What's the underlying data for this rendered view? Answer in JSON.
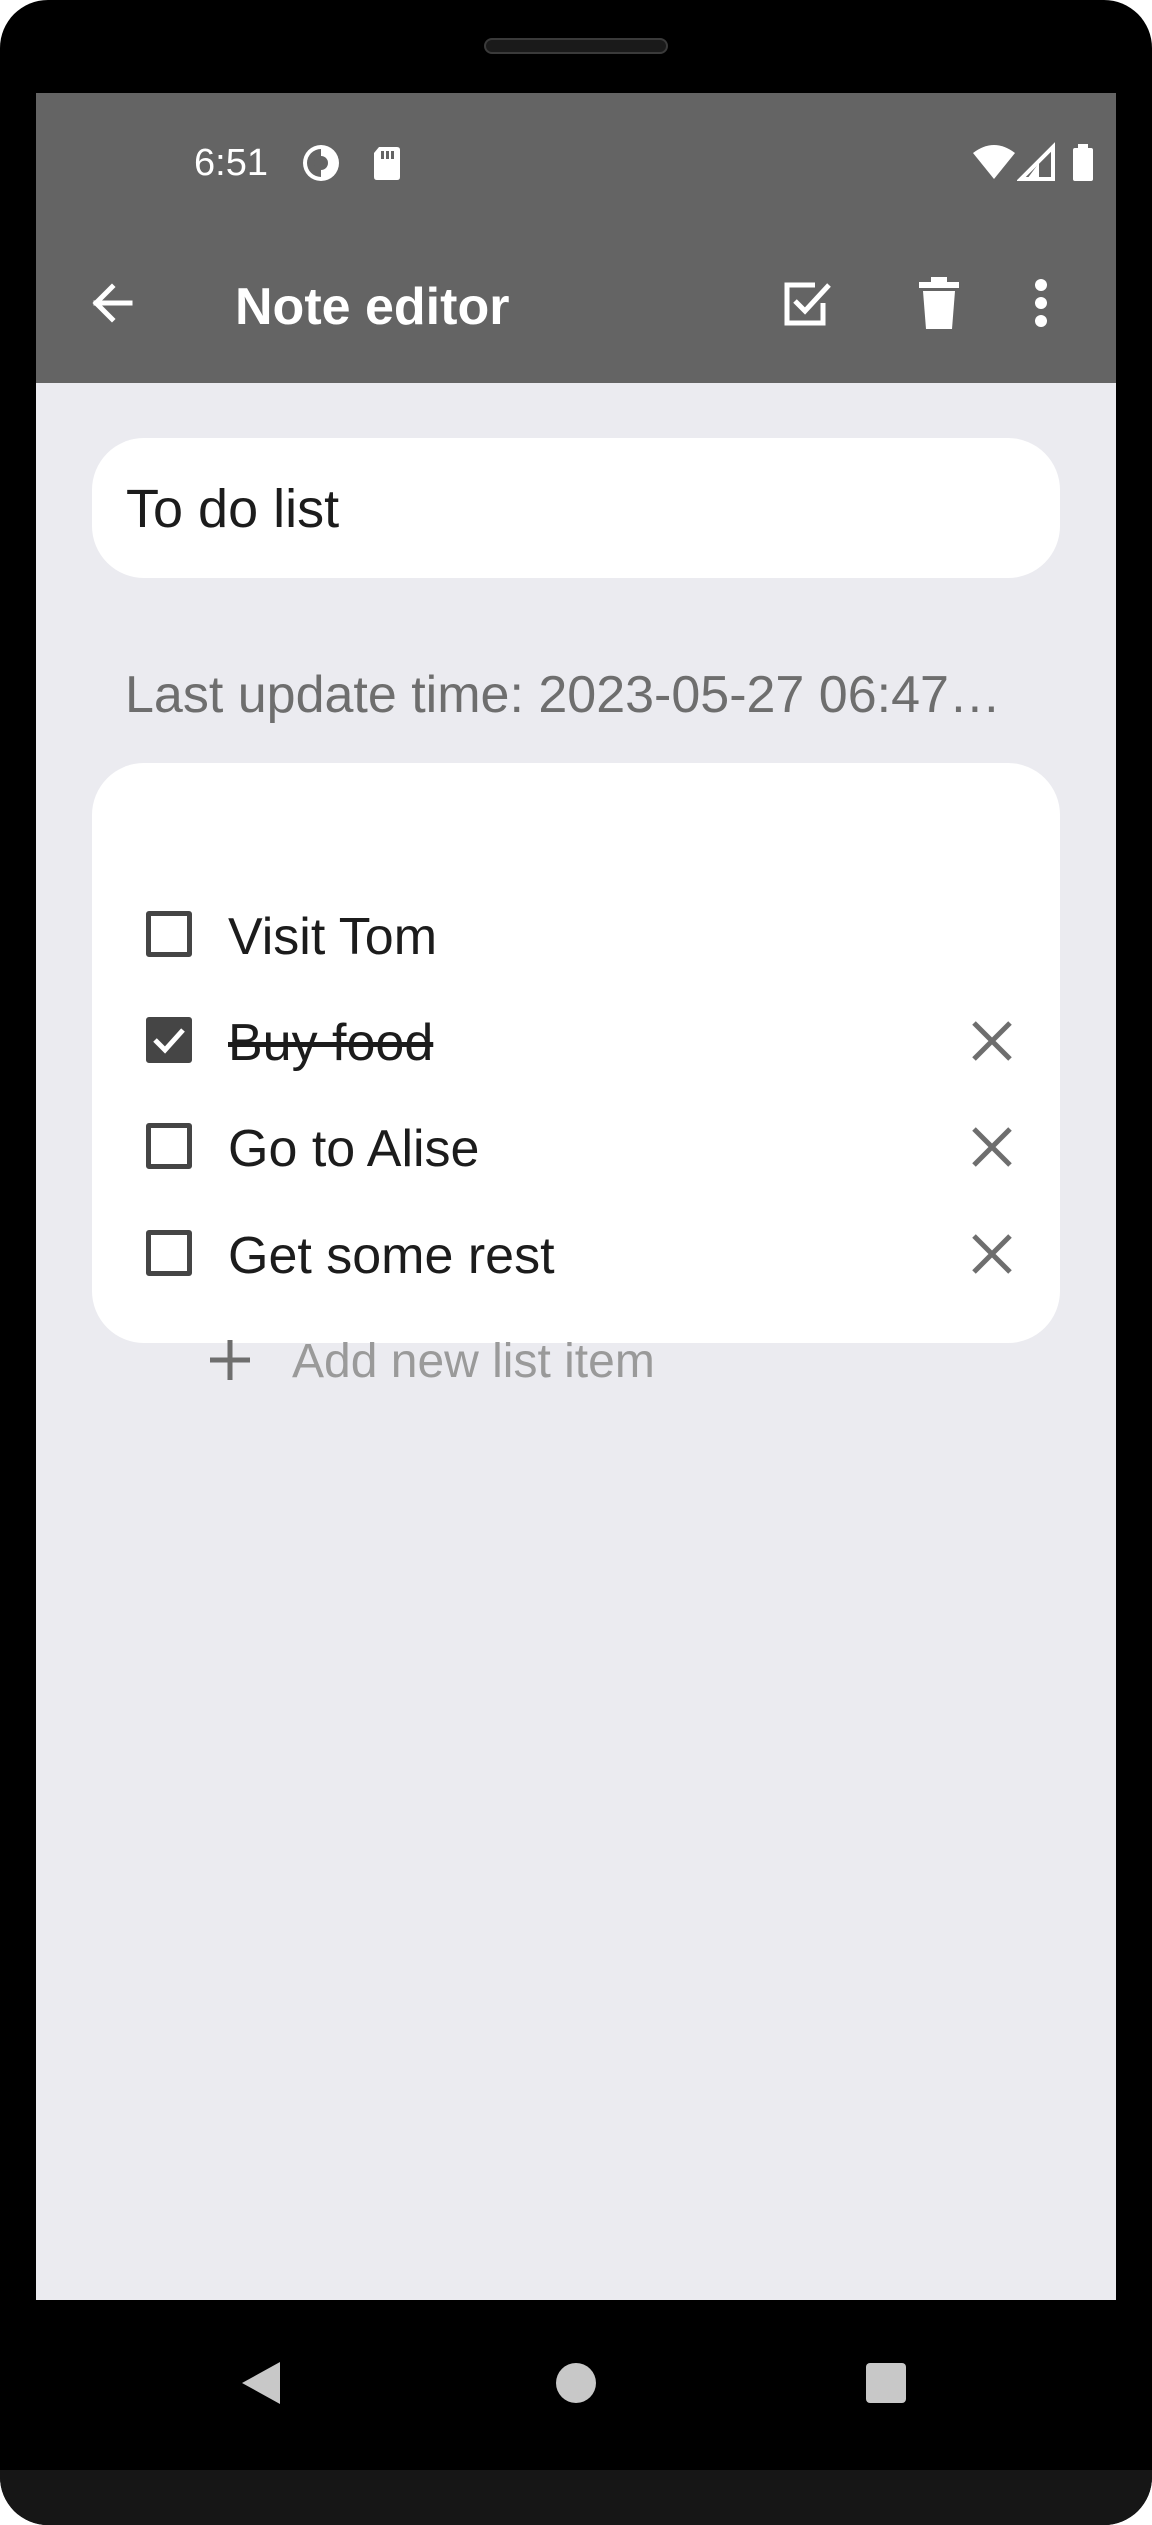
{
  "status_bar": {
    "time": "6:51",
    "icons": [
      "data-saver-icon",
      "sd-card-icon",
      "wifi-icon",
      "cell-signal-icon",
      "battery-icon"
    ]
  },
  "app_bar": {
    "title": "Note editor",
    "icons": [
      "back-arrow-icon",
      "check-box-icon",
      "trash-icon",
      "more-vert-icon"
    ]
  },
  "note": {
    "title": "To do list",
    "last_update": "Last update time: 2023-05-27 06:47…"
  },
  "checklist": {
    "items": [
      {
        "label": "Visit Tom",
        "checked": false,
        "removable": false
      },
      {
        "label": "Buy food",
        "checked": true,
        "removable": true
      },
      {
        "label": "Go to Alise",
        "checked": false,
        "removable": true
      },
      {
        "label": "Get some rest",
        "checked": false,
        "removable": true
      }
    ],
    "add_label": "Add new list item"
  },
  "nav_bar": {
    "icons": [
      "nav-back-icon",
      "nav-home-icon",
      "nav-recents-icon"
    ]
  },
  "colors": {
    "app_bar": "#646464",
    "background": "#ebebf0",
    "card": "#ffffff",
    "checkbox": "#454545",
    "hint": "#9a9a9a"
  }
}
